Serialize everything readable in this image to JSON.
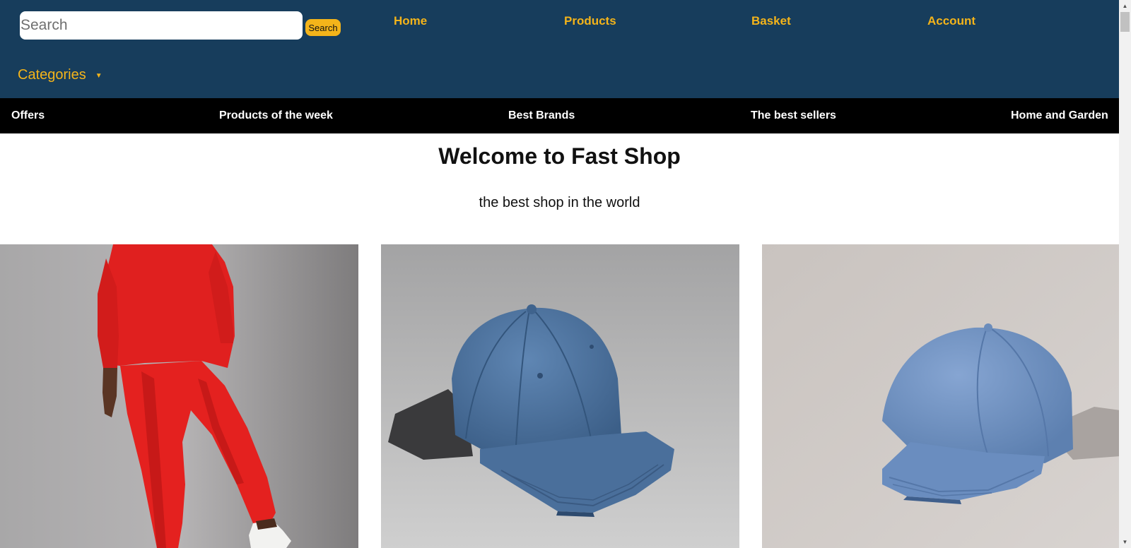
{
  "header": {
    "search": {
      "placeholder": "Search",
      "value": "",
      "button_label": "Search"
    },
    "nav": {
      "home": "Home",
      "products": "Products",
      "basket": "Basket",
      "account": "Account"
    },
    "categories_label": "Categories",
    "categories_caret": "▼"
  },
  "subnav": {
    "offers": "Offers",
    "products_of_week": "Products of the week",
    "best_brands": "Best Brands",
    "best_sellers": "The best sellers",
    "home_garden": "Home and Garden"
  },
  "hero": {
    "title": "Welcome to Fast Shop",
    "tagline": "the best shop in the world"
  },
  "products": [
    {
      "image": "red tracksuit photo"
    },
    {
      "image": "dark blue baseball cap photo"
    },
    {
      "image": "light blue baseball cap photo"
    }
  ],
  "colors": {
    "header_bg": "#173d5c",
    "accent": "#f4b41a",
    "subnav_bg": "#000000"
  },
  "scrollbar": {
    "up": "▲",
    "down": "▼"
  }
}
